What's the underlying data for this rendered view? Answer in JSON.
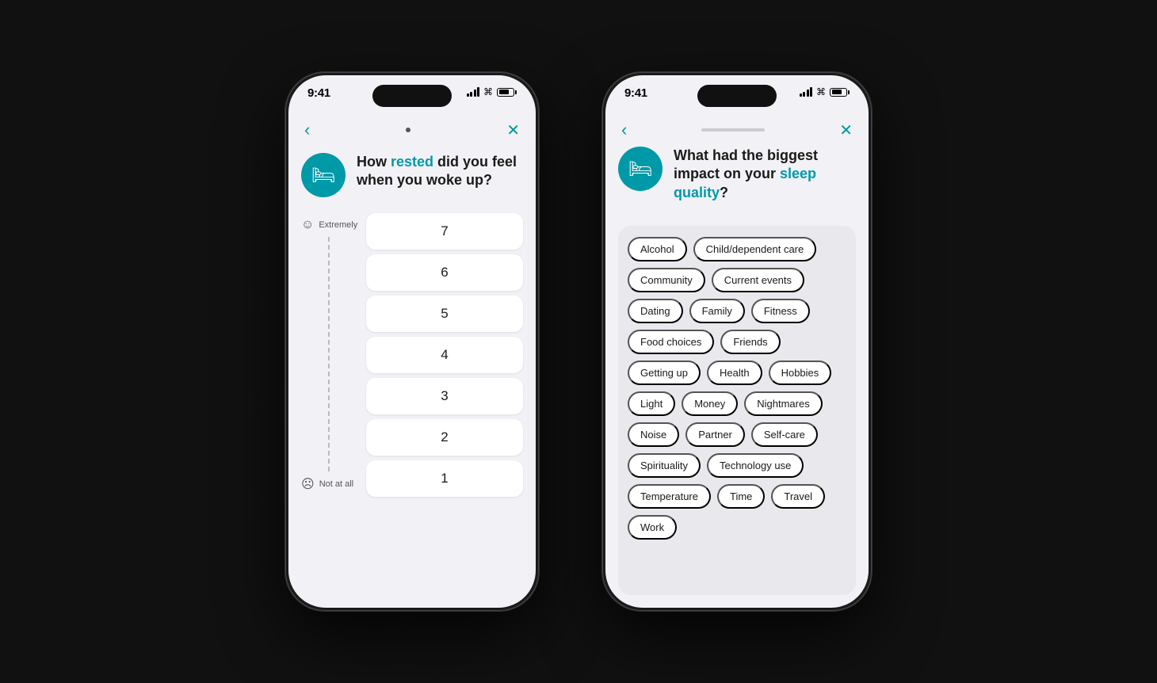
{
  "phone1": {
    "time": "9:41",
    "question": {
      "prefix": "How ",
      "highlight": "rested",
      "suffix": " did you feel when you woke up?",
      "icon": "🛏"
    },
    "scale": {
      "top_label": "Extremely",
      "bottom_label": "Not at all",
      "values": [
        "7",
        "6",
        "5",
        "4",
        "3",
        "2",
        "1"
      ]
    },
    "nav": {
      "back": "‹",
      "close": "✕"
    }
  },
  "phone2": {
    "time": "9:41",
    "question": {
      "prefix": "What had the biggest impact on your ",
      "highlight": "sleep quality",
      "suffix": "?",
      "icon": "🛏"
    },
    "tags": [
      "Alcohol",
      "Child/dependent care",
      "Community",
      "Current events",
      "Dating",
      "Family",
      "Fitness",
      "Food choices",
      "Friends",
      "Getting up",
      "Health",
      "Hobbies",
      "Light",
      "Money",
      "Nightmares",
      "Noise",
      "Partner",
      "Self-care",
      "Spirituality",
      "Technology use",
      "Temperature",
      "Time",
      "Travel",
      "Work"
    ],
    "nav": {
      "back": "‹",
      "close": "✕"
    }
  }
}
